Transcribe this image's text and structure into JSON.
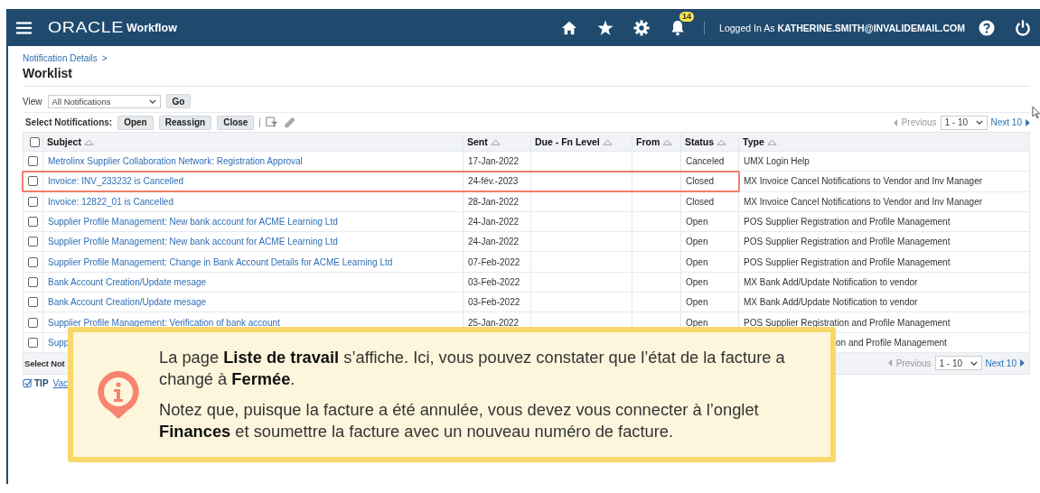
{
  "header": {
    "logo": "ORACLE",
    "app": "Workflow",
    "notifications": "14",
    "logged_in_label": "Logged In As",
    "user": "KATHERINE.SMITH@INVALIDEMAIL.COM"
  },
  "breadcrumb": "Notification Details",
  "breadcrumb_sep": ">",
  "title": "Worklist",
  "view": {
    "label": "View",
    "value": "All Notifications",
    "go": "Go"
  },
  "actions": {
    "label": "Select Notifications:",
    "buttons": [
      "Open",
      "Reassign",
      "Close"
    ]
  },
  "pagers": [
    {
      "previous": "Previous",
      "range": "1 - 10",
      "next": "Next 10"
    },
    {
      "previous": "Previous",
      "range": "1 - 10",
      "next": "Next 10"
    }
  ],
  "table": {
    "select_all_checked": false,
    "columns": [
      "Subject",
      "Sent",
      "Due - Fn Level",
      "From",
      "Status",
      "Type"
    ],
    "rows": [
      {
        "checked": false,
        "highlighted": false,
        "subject": "Metrolinx Supplier Collaboration Network: Registration Approval",
        "sent": "17-Jan-2022",
        "status": "Canceled",
        "type": "UMX Login Help"
      },
      {
        "checked": false,
        "highlighted": true,
        "subject": "Invoice: INV_233232 is Cancelled",
        "sent": "24-fév.-2023",
        "status": "Closed",
        "type": "MX Invoice Cancel Notifications to Vendor and Inv Manager"
      },
      {
        "checked": false,
        "highlighted": false,
        "subject": "Invoice: 12822_01 is Cancelled",
        "sent": "28-Jan-2022",
        "status": "Closed",
        "type": "MX Invoice Cancel Notifications to Vendor and Inv Manager"
      },
      {
        "checked": false,
        "highlighted": false,
        "subject": "Supplier Profile Management: New bank account for ACME Learning Ltd",
        "sent": "24-Jan-2022",
        "status": "Open",
        "type": "POS Supplier Registration and Profile Management"
      },
      {
        "checked": false,
        "highlighted": false,
        "subject": "Supplier Profile Management: New bank account for ACME Learning Ltd",
        "sent": "24-Jan-2022",
        "status": "Open",
        "type": "POS Supplier Registration and Profile Management"
      },
      {
        "checked": false,
        "highlighted": false,
        "subject": "Supplier Profile Management: Change in Bank Account Details for ACME Learning Ltd",
        "sent": "07-Feb-2022",
        "status": "Open",
        "type": "POS Supplier Registration and Profile Management"
      },
      {
        "checked": false,
        "highlighted": false,
        "subject": "Bank Account Creation/Update mesage",
        "sent": "03-Feb-2022",
        "status": "Open",
        "type": "MX Bank Add/Update Notification to vendor"
      },
      {
        "checked": false,
        "highlighted": false,
        "subject": "Bank Account Creation/Update mesage",
        "sent": "03-Feb-2022",
        "status": "Open",
        "type": "MX Bank Add/Update Notification to vendor"
      },
      {
        "checked": false,
        "highlighted": false,
        "subject": "Supplier Profile Management: Verification of bank account",
        "sent": "25-Jan-2022",
        "status": "Open",
        "type": "POS Supplier Registration and Profile Management"
      },
      {
        "checked": false,
        "highlighted": false,
        "covered": true,
        "subject": "Supp",
        "type": "on and Profile Management"
      }
    ]
  },
  "footer_label": "Select Not",
  "tip": {
    "label": "TIP",
    "link": "Vac"
  },
  "callout": {
    "paragraphs": [
      "La page **Liste de travail** s’affiche. Ici, vous pouvez constater que l’état de la facture a changé à **Fermée**.",
      "Notez que, puisque la facture a été annulée, vous devez vous connecter à l’onglet **Finances** et soumettre la facture avec un nouveau numéro de facture."
    ]
  }
}
